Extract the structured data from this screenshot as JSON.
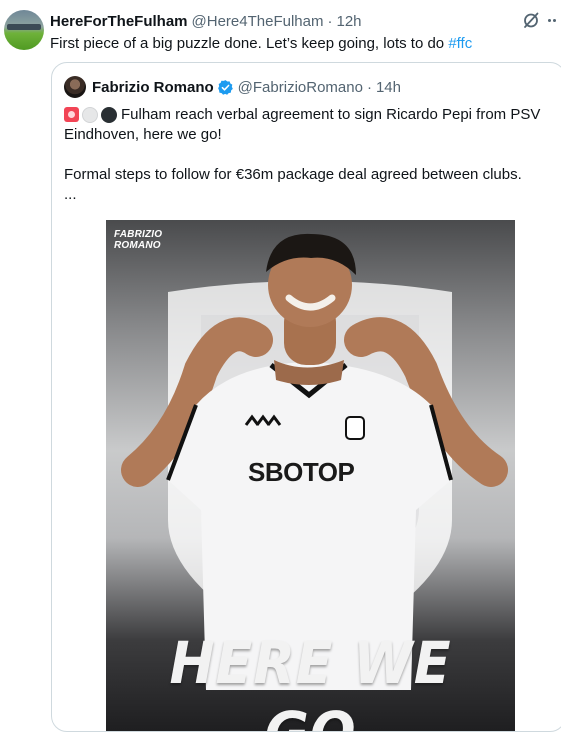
{
  "tweet": {
    "display_name": "HereForTheFulham",
    "handle": "@Here4TheFulham",
    "separator": "·",
    "time": "12h",
    "text": "First piece of a big puzzle done. Let’s keep going, lots to do ",
    "hashtag": "#ffc"
  },
  "quote": {
    "display_name": "Fabrizio Romano",
    "handle": "@FabrizioRomano",
    "separator": "·",
    "time": "14h",
    "line1": "Fulham reach verbal agreement to sign Ricardo Pepi from PSV Eindhoven, here we go!",
    "line2": "Formal steps to follow for €36m package deal agreed between clubs.",
    "line3": "...",
    "emojis": [
      "rotating-light",
      "white-circle",
      "black-circle"
    ],
    "media": {
      "watermark": "Fabrizio Romano",
      "sponsor": "SBOTOP",
      "headline": "HERE WE GO"
    }
  },
  "colors": {
    "link": "#1d9bf0",
    "secondary_text": "#536471",
    "border": "#cfd9de",
    "verified": "#1d9bf0"
  }
}
